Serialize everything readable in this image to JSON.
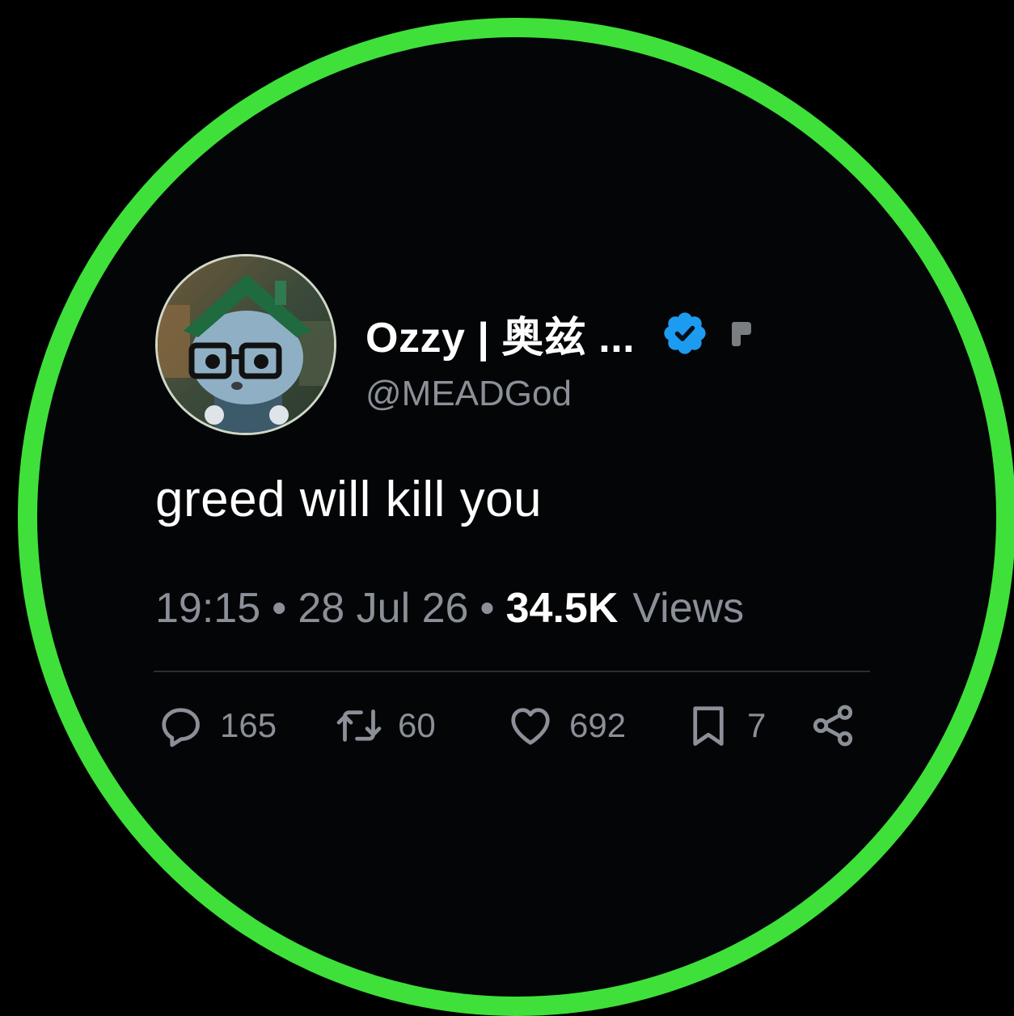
{
  "tweet": {
    "author": {
      "display_name": "Ozzy | 奥兹 ...",
      "handle": "@MEADGod",
      "verified_icon": "verified-badge-icon",
      "affiliate_icon": "affiliate-badge-icon"
    },
    "text": "greed will kill you",
    "meta": {
      "time": "19:15",
      "separator": "•",
      "date": "28 Jul 26",
      "views_count": "34.5K",
      "views_label": "Views"
    },
    "actions": {
      "replies": {
        "icon": "reply-icon",
        "count": "165"
      },
      "reposts": {
        "icon": "repost-icon",
        "count": "60"
      },
      "likes": {
        "icon": "heart-icon",
        "count": "692"
      },
      "bookmarks": {
        "icon": "bookmark-icon",
        "count": "7"
      },
      "share": {
        "icon": "share-icon"
      }
    }
  },
  "colors": {
    "ring": "#3fe03a",
    "background": "#040506",
    "text_primary": "#ffffff",
    "text_secondary": "#8b9098",
    "verified": "#1d9bf0"
  }
}
